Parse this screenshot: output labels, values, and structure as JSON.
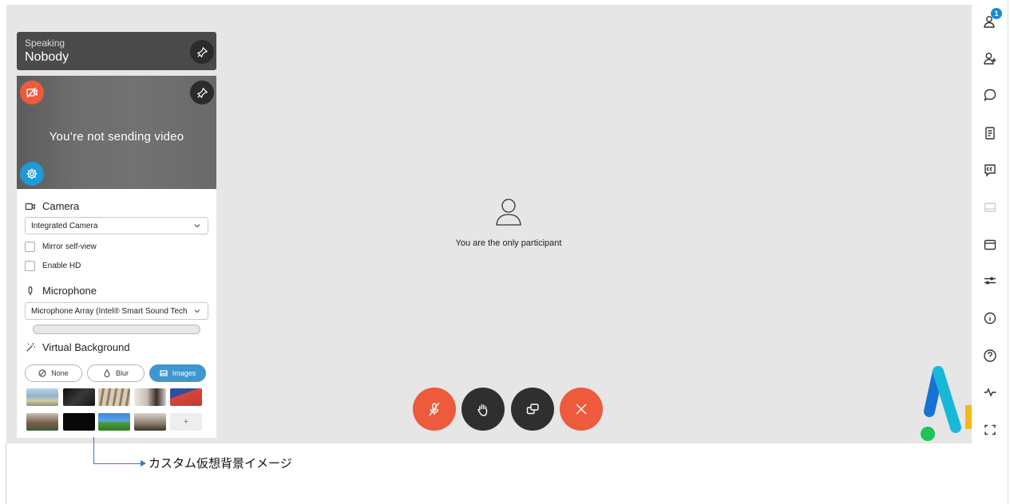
{
  "speaking": {
    "label": "Speaking",
    "name": "Nobody"
  },
  "video": {
    "status": "You’re not sending video"
  },
  "camera": {
    "heading": "Camera",
    "selected": "Integrated Camera",
    "mirror_label": "Mirror self-view",
    "hd_label": "Enable HD"
  },
  "microphone": {
    "heading": "Microphone",
    "selected": "Microphone Array (Intel® Smart Sound Tech",
    "level": 0
  },
  "virtual_background": {
    "heading": "Virtual Background",
    "options": [
      "None",
      "Blur",
      "Images"
    ],
    "selected": "Images",
    "add_label": "+"
  },
  "stage": {
    "message": "You are the only participant"
  },
  "sidebar": {
    "participants_badge": "1"
  },
  "annotation": {
    "text": "カスタム仮想背景イメージ"
  },
  "colors": {
    "accent_blue": "#1e9ad6",
    "danger_red": "#ee5a3c",
    "dark_button": "#2f2f2f",
    "stage_bg": "#e6e6e6"
  }
}
